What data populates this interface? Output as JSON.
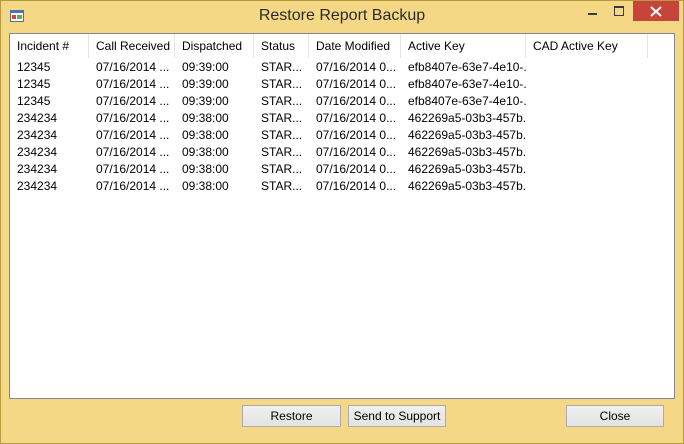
{
  "window": {
    "title": "Restore Report Backup"
  },
  "colors": {
    "titlebar": "#f5d885",
    "close_button": "#c7443a"
  },
  "icons": {
    "app": "app-window-icon",
    "minimize": "minimize-icon",
    "maximize": "maximize-icon",
    "close": "close-x-icon"
  },
  "table": {
    "columns": [
      "Incident #",
      "Call Received",
      "Dispatched",
      "Status",
      "Date Modified",
      "Active Key",
      "CAD Active Key"
    ],
    "rows": [
      [
        "12345",
        "07/16/2014 ...",
        "09:39:00",
        "STAR...",
        "07/16/2014 0...",
        "efb8407e-63e7-4e10-...",
        ""
      ],
      [
        "12345",
        "07/16/2014 ...",
        "09:39:00",
        "STAR...",
        "07/16/2014 0...",
        "efb8407e-63e7-4e10-...",
        ""
      ],
      [
        "12345",
        "07/16/2014 ...",
        "09:39:00",
        "STAR...",
        "07/16/2014 0...",
        "efb8407e-63e7-4e10-...",
        ""
      ],
      [
        "234234",
        "07/16/2014 ...",
        "09:38:00",
        "STAR...",
        "07/16/2014 0...",
        "462269a5-03b3-457b...",
        ""
      ],
      [
        "234234",
        "07/16/2014 ...",
        "09:38:00",
        "STAR...",
        "07/16/2014 0...",
        "462269a5-03b3-457b...",
        ""
      ],
      [
        "234234",
        "07/16/2014 ...",
        "09:38:00",
        "STAR...",
        "07/16/2014 0...",
        "462269a5-03b3-457b...",
        ""
      ],
      [
        "234234",
        "07/16/2014 ...",
        "09:38:00",
        "STAR...",
        "07/16/2014 0...",
        "462269a5-03b3-457b...",
        ""
      ],
      [
        "234234",
        "07/16/2014 ...",
        "09:38:00",
        "STAR...",
        "07/16/2014 0...",
        "462269a5-03b3-457b...",
        ""
      ]
    ]
  },
  "buttons": {
    "restore": "Restore",
    "send_support": "Send to Support",
    "close": "Close"
  }
}
